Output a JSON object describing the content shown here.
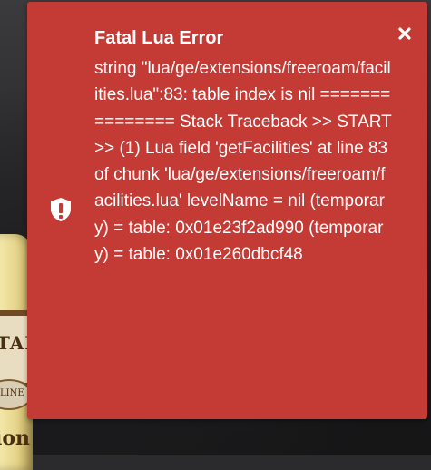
{
  "toast": {
    "title": "Fatal Lua Error",
    "message": "string \"lua/ge/extensions/freeroam/facilities.lua\":83: table index is nil =============== Stack Traceback >> START >> (1) Lua field 'getFacilities' at line 83 of chunk 'lua/ge/extensions/freeroam/facilities.lua' levelName = nil (temporary) = table: 0x01e23f2ad990 (temporary) = table: 0x01e260dbcf48",
    "icon": "shield-exclamation-icon",
    "close_icon": "close-icon",
    "background_color": "#c43a35",
    "text_color": "#ffffff"
  },
  "background": {
    "bottle_label_text": "TAI",
    "bottle_seal_text": "LINE",
    "bottle_bottom_text": "ion"
  }
}
